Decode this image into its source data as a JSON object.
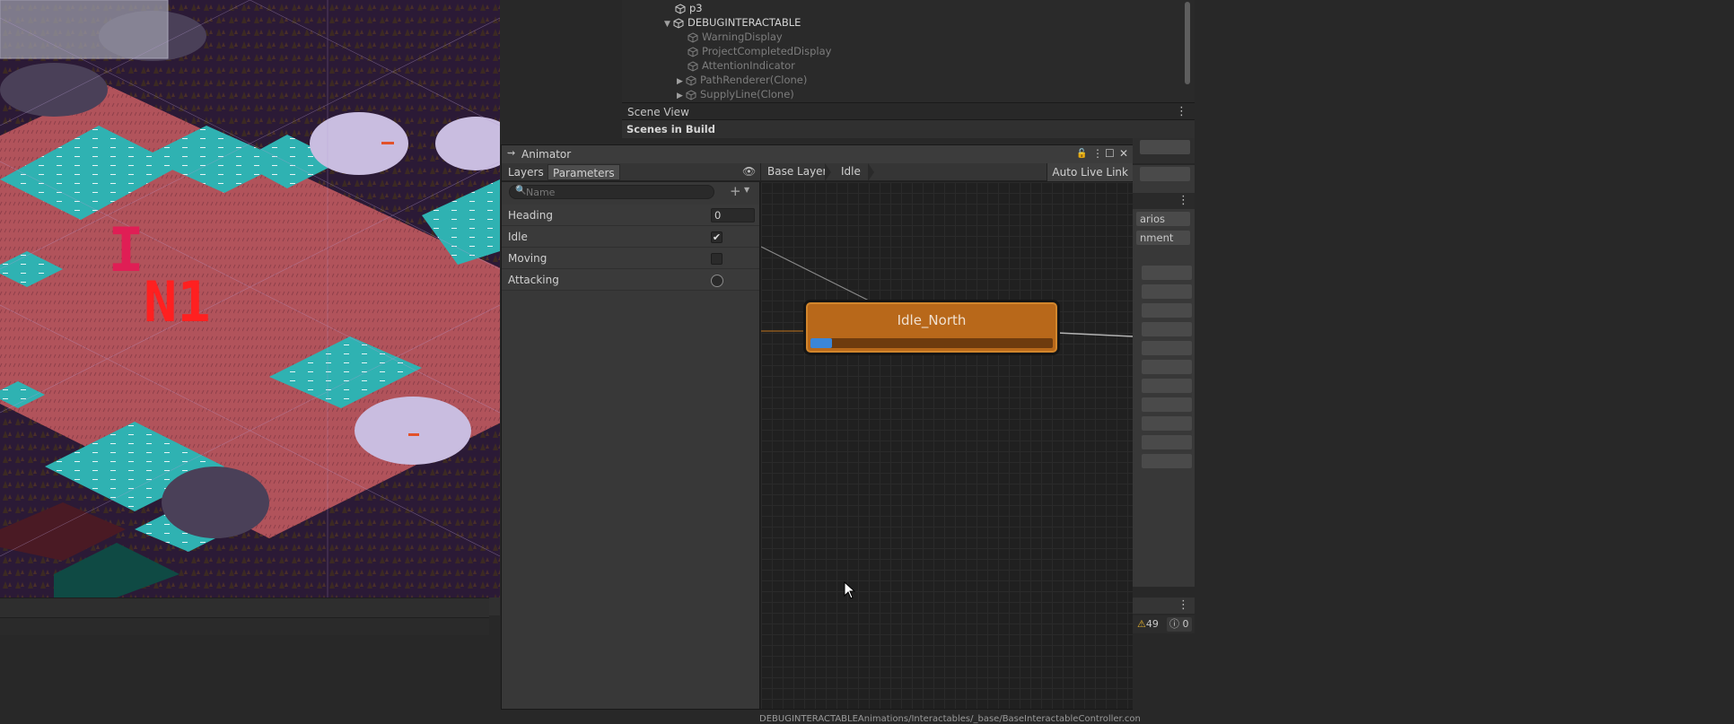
{
  "hierarchy": {
    "items": [
      {
        "label": "p3",
        "expanded": null
      },
      {
        "label": "DEBUGINTERACTABLE",
        "expanded": true
      },
      {
        "label": "WarningDisplay",
        "expanded": null
      },
      {
        "label": "ProjectCompletedDisplay",
        "expanded": null
      },
      {
        "label": "AttentionIndicator",
        "expanded": null
      },
      {
        "label": "PathRenderer(Clone)",
        "expanded": false
      },
      {
        "label": "SupplyLine(Clone)",
        "expanded": false
      }
    ]
  },
  "scene_view": {
    "tab_label": "Scene View"
  },
  "build_settings": {
    "heading": "Scenes in Build"
  },
  "inspector_fragments": {
    "line1": "arios",
    "line2": "nment"
  },
  "animator": {
    "window_title": "Animator",
    "tabs": {
      "layers": "Layers",
      "parameters": "Parameters"
    },
    "search": {
      "placeholder": "Name"
    },
    "breadcrumb": {
      "layer": "Base Layer",
      "state": "Idle"
    },
    "auto_live_link": "Auto Live Link",
    "parameters": [
      {
        "name": "Heading",
        "type": "float",
        "value": "0"
      },
      {
        "name": "Idle",
        "type": "bool",
        "value": "✔"
      },
      {
        "name": "Moving",
        "type": "bool",
        "value": ""
      },
      {
        "name": "Attacking",
        "type": "trigger",
        "value": ""
      }
    ],
    "state_node": {
      "name": "Idle_North",
      "progress": 0.09
    },
    "footer_path": "DEBUGINTERACTABLEAnimations/Interactables/_base/BaseInteractableController.con"
  },
  "console": {
    "warnings": "49",
    "errors": "0"
  },
  "game_overlay_letters": {
    "a": "I",
    "b": "N1"
  },
  "colors": {
    "state_orange": "#b8681a",
    "progress_blue": "#3b86d8",
    "teal_tile": "#2fb2b2",
    "salmon_tile": "#b1535b"
  }
}
